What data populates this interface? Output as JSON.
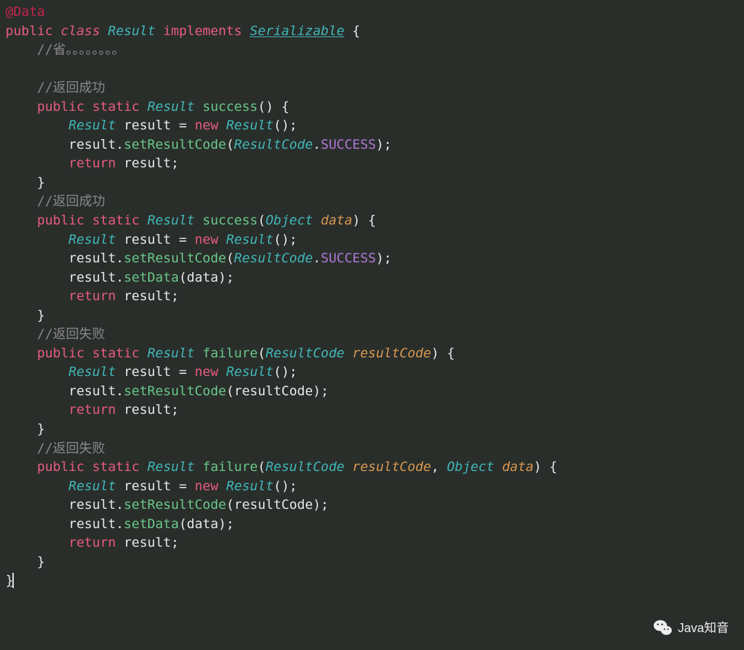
{
  "code": {
    "annotation": "@Data",
    "keyword_public": "public",
    "keyword_class": "class",
    "keyword_implements": "implements",
    "keyword_static": "static",
    "keyword_new": "new",
    "keyword_return": "return",
    "class_result": "Result",
    "class_serializable": "Serializable",
    "class_object": "Object",
    "class_resultcode": "ResultCode",
    "brace_open": "{",
    "brace_close": "}",
    "paren_open": "(",
    "paren_close": ")",
    "semicolon": ";",
    "comma": ",",
    "equals": "=",
    "dot": ".",
    "comment_omit": "//省。。。。。。。。",
    "comment_success": "//返回成功",
    "comment_failure": "//返回失败",
    "method_success": "success",
    "method_failure": "failure",
    "method_setresultcode": "setResultCode",
    "method_setdata": "setData",
    "var_result": "result",
    "param_data": "data",
    "param_resultcode": "resultCode",
    "constant_success": "SUCCESS"
  },
  "watermark": {
    "text": "Java知音"
  }
}
